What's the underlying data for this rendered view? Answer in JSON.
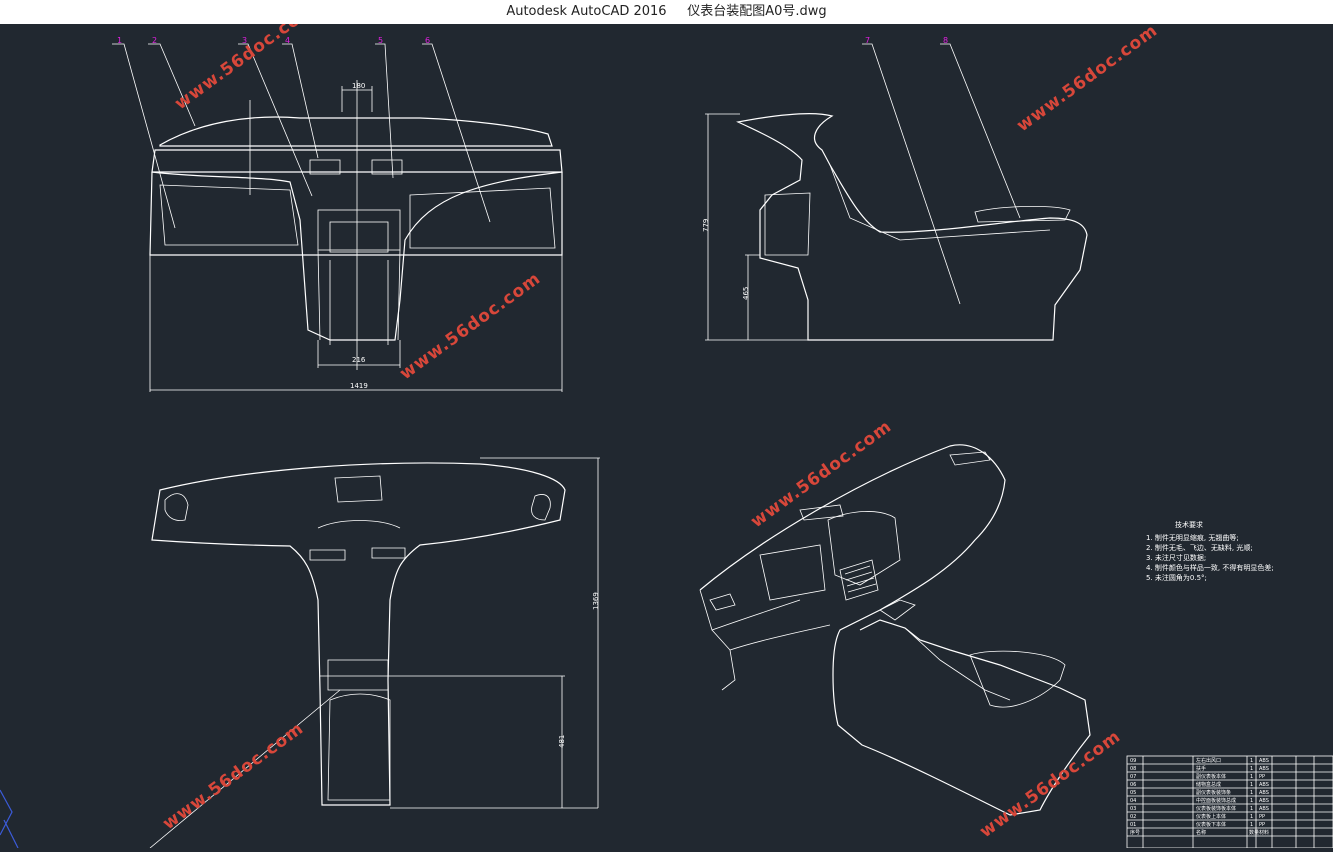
{
  "window": {
    "title": "Autodesk AutoCAD 2016",
    "document": "仪表台装配图A0号.dwg"
  },
  "balloons": [
    "1",
    "2",
    "3",
    "4",
    "5",
    "6",
    "7",
    "8"
  ],
  "dimensions": {
    "top_width": "180",
    "bottom_inner": "216",
    "overall_width": "1419",
    "side_height": "779",
    "side_lower": "465",
    "plan_length": "1369",
    "plan_partial": "481"
  },
  "watermark": "www.56doc.com",
  "tech_notes": {
    "title": "技术要求",
    "items": [
      "1. 制件无明显缩痕, 无翘曲等;",
      "2. 制件无毛、飞边、无缺料, 光顺;",
      "3. 未注尺寸见数据;",
      "4. 制件颜色与样品一致, 不得有明显色差;",
      "5. 未注圆角为0.5°;"
    ]
  },
  "bom": {
    "rows": [
      {
        "no": "09",
        "name": "左右出风口",
        "qty": "1",
        "mat": "ABS"
      },
      {
        "no": "08",
        "name": "扶手",
        "qty": "1",
        "mat": "ABS"
      },
      {
        "no": "07",
        "name": "副仪表板本体",
        "qty": "1",
        "mat": "PP"
      },
      {
        "no": "06",
        "name": "储物盒总成",
        "qty": "1",
        "mat": "ABS"
      },
      {
        "no": "05",
        "name": "副仪表板装饰条",
        "qty": "1",
        "mat": "ABS"
      },
      {
        "no": "04",
        "name": "中控面板装饰总成",
        "qty": "1",
        "mat": "ABS"
      },
      {
        "no": "03",
        "name": "仪表板装饰板本体",
        "qty": "1",
        "mat": "ABS"
      },
      {
        "no": "02",
        "name": "仪表板上本体",
        "qty": "1",
        "mat": "PP"
      },
      {
        "no": "01",
        "name": "仪表板下本体",
        "qty": "1",
        "mat": "PP"
      }
    ],
    "header": {
      "no": "序号",
      "name": "名称",
      "qty": "数量",
      "mat": "材料"
    }
  }
}
